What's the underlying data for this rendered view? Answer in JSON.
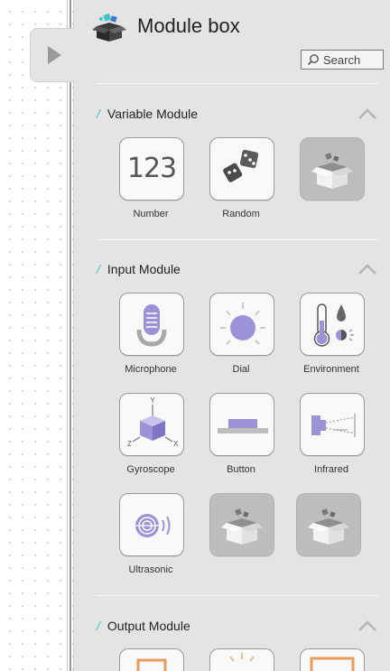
{
  "panel": {
    "title": "Module box",
    "search_label": "Search"
  },
  "sections": [
    {
      "title": "Variable Module",
      "modules": [
        {
          "label": "Number",
          "icon_text": "123",
          "icon": "number-icon"
        },
        {
          "label": "Random",
          "icon": "dice-icon"
        },
        {
          "label": "",
          "icon": "empty-box-icon"
        }
      ]
    },
    {
      "title": "Input Module",
      "modules": [
        {
          "label": "Microphone",
          "icon": "microphone-icon"
        },
        {
          "label": "Dial",
          "icon": "dial-icon"
        },
        {
          "label": "Environment",
          "icon": "thermometer-icon"
        },
        {
          "label": "Gyroscope",
          "icon": "gyroscope-icon",
          "axis_labels": [
            "Y",
            "Z",
            "X"
          ]
        },
        {
          "label": "Button",
          "icon": "button-icon"
        },
        {
          "label": "Infrared",
          "icon": "infrared-icon"
        },
        {
          "label": "Ultrasonic",
          "icon": "ultrasonic-icon"
        },
        {
          "label": "",
          "icon": "empty-box-icon"
        },
        {
          "label": "",
          "icon": "empty-box-icon"
        }
      ]
    },
    {
      "title": "Output Module"
    }
  ],
  "colors": {
    "accent_slash": "#3cc6c6",
    "icon_purple": "#9b92d8",
    "panel_bg": "#e4e4e4",
    "output_orange": "#e89a5a"
  }
}
